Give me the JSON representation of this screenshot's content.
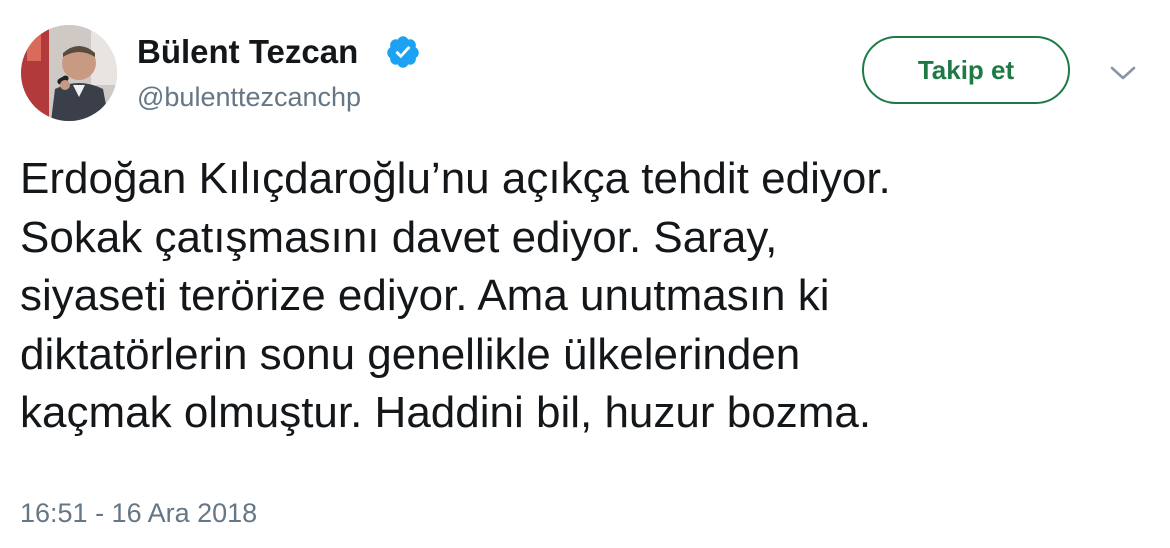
{
  "user": {
    "display_name": "Bülent Tezcan",
    "handle": "@bulenttezcanchp",
    "verified": true
  },
  "actions": {
    "follow_label": "Takip et",
    "more_icon": "chevron-down-icon"
  },
  "tweet": {
    "lines": [
      "Erdoğan Kılıçdaroğlu’nu açıkça tehdit ediyor.",
      "Sokak çatışmasını davet ediyor. Saray,",
      "siyaseti terörize ediyor. Ama unutmasın ki",
      "diktatörlerin sonu genellikle ülkelerinden",
      "kaçmak olmuştur. Haddini bil, huzur bozma."
    ],
    "timestamp": "16:51 - 16 Ara 2018"
  },
  "colors": {
    "follow_accent": "#1e7a45",
    "verified_blue": "#1da1f2",
    "secondary_text": "#657786",
    "primary_text": "#14171a"
  }
}
